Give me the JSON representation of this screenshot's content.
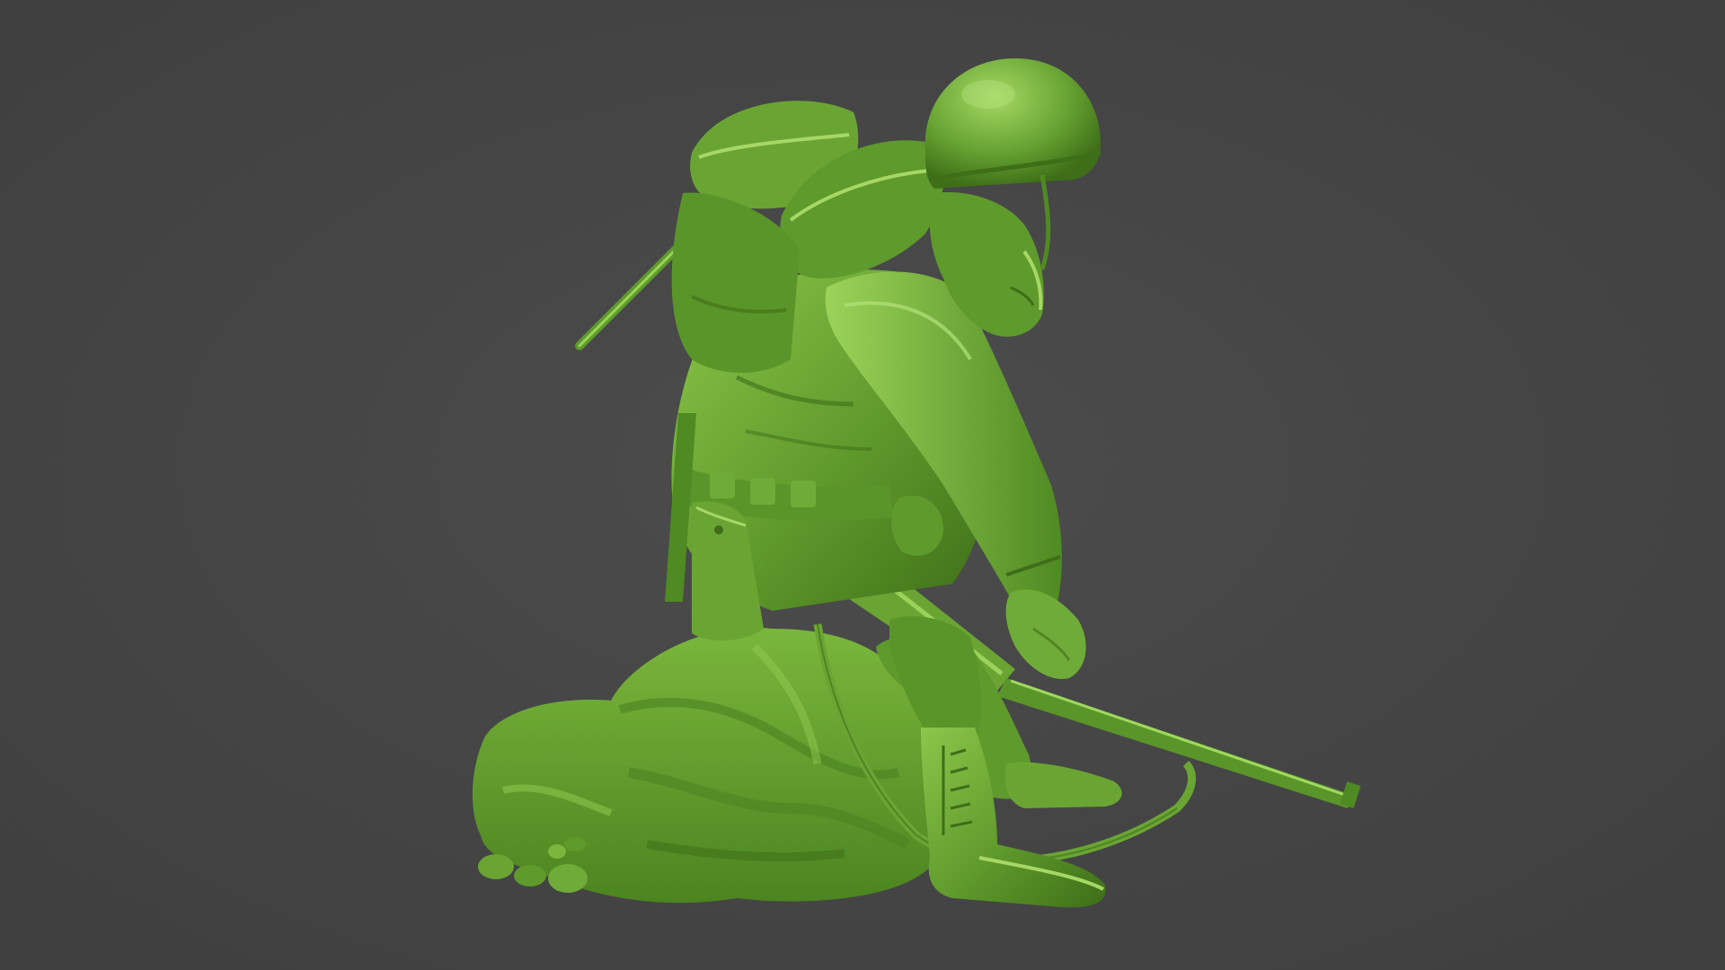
{
  "scene": {
    "subject": "soldier-figurine-icon",
    "colors": {
      "background": "#454545",
      "model_base": "#5f9a2c",
      "model_light": "#86c244",
      "model_highlight": "#a6d866",
      "model_dark": "#3e6e18",
      "model_deep": "#2c5210"
    }
  }
}
